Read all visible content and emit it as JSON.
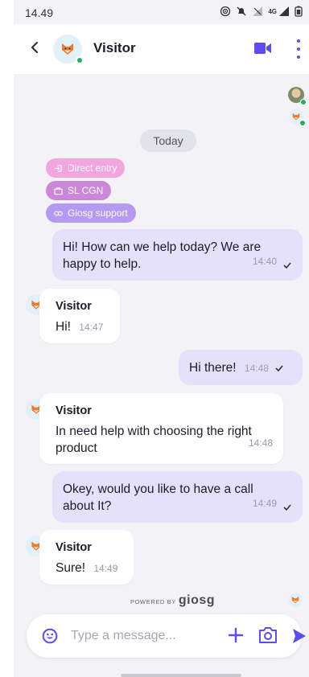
{
  "status_bar": {
    "time": "14.49",
    "network": "4G"
  },
  "header": {
    "title": "Visitor"
  },
  "chat": {
    "date_separator": "Today",
    "tags": [
      {
        "label": "Direct entry",
        "icon": "login-icon",
        "color": "#f2a6e0"
      },
      {
        "label": "SL CGN",
        "icon": "briefcase-icon",
        "color": "#cc88d8"
      },
      {
        "label": "Giosg support",
        "icon": "link-icon",
        "color": "#b49af0"
      }
    ],
    "messages": [
      {
        "direction": "out",
        "text": "Hi! How can we help today? We are happy to help.",
        "time": "14:40",
        "status": "sent"
      },
      {
        "direction": "in",
        "sender": "Visitor",
        "text": "Hi!",
        "time": "14:47"
      },
      {
        "direction": "out",
        "text": "Hi there!",
        "time": "14:48",
        "status": "sent"
      },
      {
        "direction": "in",
        "sender": "Visitor",
        "text": "In need help with choosing the right product",
        "time": "14:48"
      },
      {
        "direction": "out",
        "text": "Okey, would you like to have a call about It?",
        "time": "14:49",
        "status": "sent"
      },
      {
        "direction": "in",
        "sender": "Visitor",
        "text": "Sure!",
        "time": "14:49"
      }
    ]
  },
  "footer": {
    "powered_by": "POWERED BY",
    "brand": "giosg"
  },
  "composer": {
    "placeholder": "Type a message..."
  },
  "colors": {
    "accent": "#5b4cf5",
    "outgoing_bubble": "#e5e1fb",
    "background": "#f3f3f7",
    "online": "#27ae60"
  }
}
